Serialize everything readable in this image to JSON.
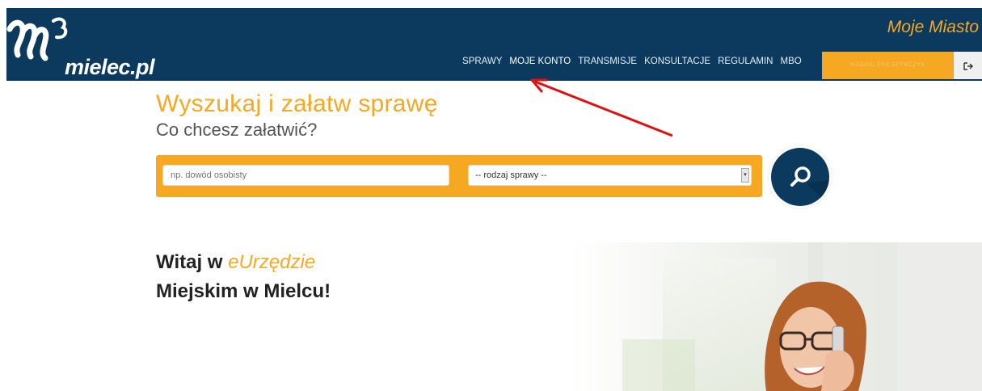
{
  "header": {
    "logo_text": "mielec.pl",
    "city_title": "Moje Miasto",
    "nav": [
      {
        "label": "SPRAWY"
      },
      {
        "label": "MOJE KONTO"
      },
      {
        "label": "TRANSMISJE"
      },
      {
        "label": "KONSULTACJE"
      },
      {
        "label": "REGULAMIN"
      },
      {
        "label": "MBO"
      }
    ],
    "login_label": "MAGDALENA SZYMCZYK",
    "logout_icon": "logout-icon"
  },
  "search": {
    "title": "Wyszukaj i załatw sprawę",
    "subtitle": "Co chcesz załatwić?",
    "input_placeholder": "np. dowód osobisty",
    "select_value": "-- rodzaj sprawy --",
    "button_icon": "search-icon"
  },
  "welcome": {
    "prefix": "Witaj w ",
    "accent": "eUrzędzie",
    "line2": "Miejskim w Mielcu!"
  },
  "colors": {
    "navy": "#0b3a5e",
    "orange": "#f7a823",
    "annotation_red": "#e01010"
  }
}
